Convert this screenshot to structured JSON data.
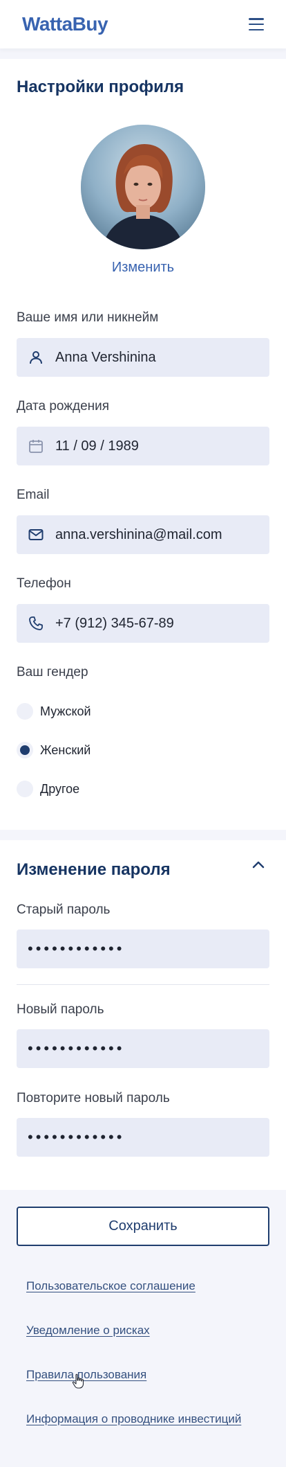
{
  "header": {
    "logo": "WattaBuy",
    "menu_icon": "hamburger-menu-icon"
  },
  "profile": {
    "title": "Настройки профиля",
    "change_photo": "Изменить",
    "name": {
      "label": "Ваше имя или никнейм",
      "value": "Anna Vershinina",
      "icon": "user-icon"
    },
    "birthdate": {
      "label": "Дата рождения",
      "value": "11 / 09 / 1989",
      "icon": "calendar-icon"
    },
    "email": {
      "label": "Email",
      "value": "anna.vershinina@mail.com",
      "icon": "mail-icon"
    },
    "phone": {
      "label": "Телефон",
      "value": "+7 (912) 345-67-89",
      "icon": "phone-icon"
    },
    "gender": {
      "label": "Ваш гендер",
      "options": [
        "Мужской",
        "Женский",
        "Другое"
      ],
      "selected": "Женский"
    }
  },
  "password": {
    "title": "Изменение пароля",
    "old": {
      "label": "Старый пароль",
      "value": "••••••••••••"
    },
    "new": {
      "label": "Новый пароль",
      "value": "••••••••••••"
    },
    "repeat": {
      "label": "Повторите новый пароль",
      "value": "••••••••••••"
    }
  },
  "save_label": "Сохранить",
  "footer_links": [
    "Пользовательское соглашение",
    "Уведомление о рисках",
    "Правила пользования",
    "Информация о проводнике инвестиций"
  ],
  "colors": {
    "brand": "#3863b0",
    "dark": "#1f3d6e",
    "field_bg": "#e8ebf6"
  }
}
